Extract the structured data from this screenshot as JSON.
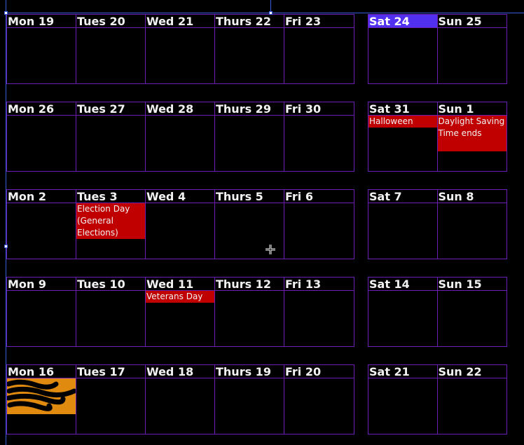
{
  "calendar": {
    "weeks": [
      {
        "weekdays": [
          {
            "label": "Mon 19",
            "events": []
          },
          {
            "label": "Tues 20",
            "events": []
          },
          {
            "label": "Wed 21",
            "events": []
          },
          {
            "label": "Thurs 22",
            "events": []
          },
          {
            "label": "Fri 23",
            "events": []
          }
        ],
        "weekend": [
          {
            "label": "Sat 24",
            "selected": true,
            "events": []
          },
          {
            "label": "Sun 25",
            "events": []
          }
        ]
      },
      {
        "weekdays": [
          {
            "label": "Mon 26",
            "events": []
          },
          {
            "label": "Tues 27",
            "events": []
          },
          {
            "label": "Wed 28",
            "events": []
          },
          {
            "label": "Thurs 29",
            "events": []
          },
          {
            "label": "Fri 30",
            "events": []
          }
        ],
        "weekend": [
          {
            "label": "Sat 31",
            "events": [
              {
                "title": "Halloween",
                "color": "#c00000"
              }
            ]
          },
          {
            "label": "Sun 1",
            "events": [
              {
                "title": "Daylight Saving Time ends",
                "color": "#c00000"
              }
            ]
          }
        ]
      },
      {
        "weekdays": [
          {
            "label": "Mon 2",
            "events": []
          },
          {
            "label": "Tues 3",
            "events": [
              {
                "title": "Election Day (General Elections)",
                "color": "#c00000"
              }
            ]
          },
          {
            "label": "Wed 4",
            "events": []
          },
          {
            "label": "Thurs 5",
            "events": []
          },
          {
            "label": "Fri 6",
            "events": []
          }
        ],
        "weekend": [
          {
            "label": "Sat 7",
            "events": []
          },
          {
            "label": "Sun 8",
            "events": []
          }
        ]
      },
      {
        "weekdays": [
          {
            "label": "Mon 9",
            "events": []
          },
          {
            "label": "Tues 10",
            "events": []
          },
          {
            "label": "Wed 11",
            "events": [
              {
                "title": "Veterans Day",
                "color": "#c00000"
              }
            ]
          },
          {
            "label": "Thurs 12",
            "events": []
          },
          {
            "label": "Fri 13",
            "events": []
          }
        ],
        "weekend": [
          {
            "label": "Sat 14",
            "events": []
          },
          {
            "label": "Sun 15",
            "events": []
          }
        ]
      },
      {
        "weekdays": [
          {
            "label": "Mon 16",
            "events": [
              {
                "title": "",
                "color": "#e08a10",
                "redacted": true
              }
            ]
          },
          {
            "label": "Tues 17",
            "events": []
          },
          {
            "label": "Wed 18",
            "events": []
          },
          {
            "label": "Thurs 19",
            "events": []
          },
          {
            "label": "Fri 20",
            "events": []
          }
        ],
        "weekend": [
          {
            "label": "Sat 21",
            "events": []
          },
          {
            "label": "Sun 22",
            "events": []
          }
        ]
      }
    ]
  },
  "colors": {
    "grid_line": "#6a1fb3",
    "selected_header": "#5230f0",
    "holiday_event": "#c00000",
    "personal_event": "#e08a10",
    "background": "#000000"
  },
  "icons": {
    "cursor": "crosshair-move-cursor-icon",
    "selection_handles": "selection-handle-icon"
  }
}
